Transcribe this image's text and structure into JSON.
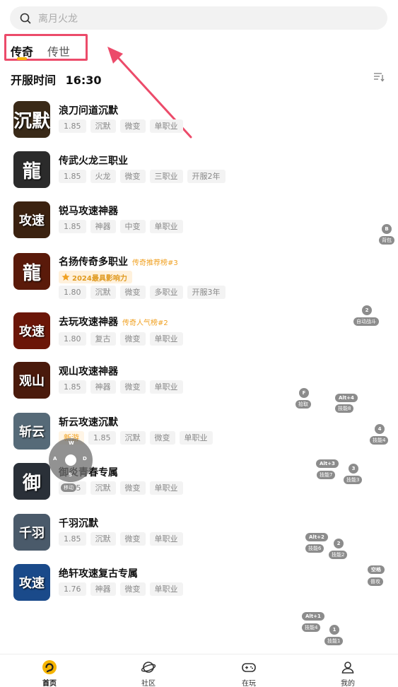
{
  "search": {
    "placeholder": "离月火龙"
  },
  "tabs": [
    {
      "label": "传奇",
      "active": true
    },
    {
      "label": "传世",
      "active": false
    }
  ],
  "open_time": {
    "label": "开服时间",
    "time": "16:30"
  },
  "games": [
    {
      "title": "浪刀问道沉默",
      "thumb_text": "沉默",
      "thumb_color": "#3a2a18",
      "tags": [
        "1.85",
        "沉默",
        "微变",
        "单职业"
      ]
    },
    {
      "title": "传武火龙三职业",
      "thumb_text": "龍",
      "thumb_color": "#2b2b2b",
      "tags": [
        "1.85",
        "火龙",
        "微变",
        "三职业",
        "开服2年"
      ]
    },
    {
      "title": "锐马攻速神器",
      "thumb_text": "攻速",
      "thumb_color": "#3b2210",
      "tags": [
        "1.85",
        "神器",
        "中变",
        "单职业"
      ]
    },
    {
      "title": "名扬传奇多职业",
      "rank": "传奇推荐榜#3",
      "badge": "2024最具影响力",
      "thumb_text": "龍",
      "thumb_color": "#5a1a0a",
      "tags": [
        "1.80",
        "沉默",
        "微变",
        "多职业",
        "开服3年"
      ]
    },
    {
      "title": "去玩攻速神器",
      "rank": "传奇人气榜#2",
      "thumb_text": "攻速",
      "thumb_color": "#6b1608",
      "tags": [
        "1.80",
        "复古",
        "微变",
        "单职业"
      ]
    },
    {
      "title": "观山攻速神器",
      "thumb_text": "观山",
      "thumb_color": "#4a1a0c",
      "tags": [
        "1.85",
        "神器",
        "微变",
        "单职业"
      ]
    },
    {
      "title": "斩云攻速沉默",
      "thumb_text": "斩云",
      "thumb_color": "#566a78",
      "tags": [
        "新游",
        "1.85",
        "沉默",
        "微变",
        "单职业"
      ]
    },
    {
      "title": "御炎青春专属",
      "thumb_text": "御",
      "thumb_color": "#2a3038",
      "tags": [
        "1.85",
        "沉默",
        "微变",
        "单职业"
      ]
    },
    {
      "title": "千羽沉默",
      "thumb_text": "千羽",
      "thumb_color": "#4a5a6a",
      "tags": [
        "1.85",
        "沉默",
        "微变",
        "单职业"
      ]
    },
    {
      "title": "绝轩攻速复古专属",
      "thumb_text": "攻速",
      "thumb_color": "#1a4a8a",
      "tags": [
        "1.76",
        "神器",
        "微变",
        "单职业"
      ]
    }
  ],
  "overlay": {
    "joystick": {
      "up": "W",
      "left": "A",
      "down": "S",
      "right": "D",
      "label": "移动"
    },
    "keys": [
      {
        "key": "B",
        "label": "背包"
      },
      {
        "key": "2",
        "label": "自动战斗"
      },
      {
        "key": "F",
        "label": "拾取"
      },
      {
        "key": "Alt+4",
        "label": "技能8"
      },
      {
        "key": "4",
        "label": "技能4"
      },
      {
        "key": "Alt+3",
        "label": "技能7"
      },
      {
        "key": "3",
        "label": "技能3"
      },
      {
        "key": "Alt+2",
        "label": "技能6"
      },
      {
        "key": "2",
        "label": "技能2"
      },
      {
        "key": "空格",
        "label": "普攻"
      },
      {
        "key": "Alt+1",
        "label": "技能4"
      },
      {
        "key": "1",
        "label": "技能1"
      }
    ]
  },
  "bottom_nav": [
    {
      "label": "首页",
      "icon": "home-icon",
      "active": true
    },
    {
      "label": "社区",
      "icon": "planet-icon",
      "active": false
    },
    {
      "label": "在玩",
      "icon": "gamepad-icon",
      "active": false
    },
    {
      "label": "我的",
      "icon": "user-icon",
      "active": false
    }
  ],
  "colors": {
    "accent": "#f5b400",
    "highlight_box": "#ec4b6a",
    "rank": "#f0a020"
  }
}
